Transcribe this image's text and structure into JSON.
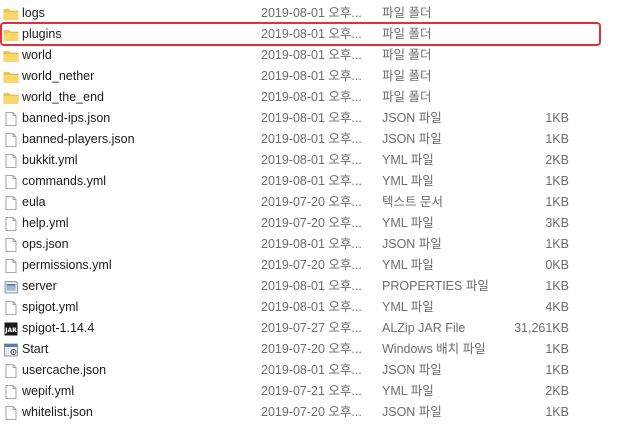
{
  "files": [
    {
      "name": "logs",
      "date": "2019-08-01 오후...",
      "type": "파일 폴더",
      "size": "",
      "icon": "folder-icon"
    },
    {
      "name": "plugins",
      "date": "2019-08-01 오후...",
      "type": "파일 폴더",
      "size": "",
      "icon": "folder-icon"
    },
    {
      "name": "world",
      "date": "2019-08-01 오후...",
      "type": "파일 폴더",
      "size": "",
      "icon": "folder-icon"
    },
    {
      "name": "world_nether",
      "date": "2019-08-01 오후...",
      "type": "파일 폴더",
      "size": "",
      "icon": "folder-icon"
    },
    {
      "name": "world_the_end",
      "date": "2019-08-01 오후...",
      "type": "파일 폴더",
      "size": "",
      "icon": "folder-icon"
    },
    {
      "name": "banned-ips.json",
      "date": "2019-08-01 오후...",
      "type": "JSON 파일",
      "size": "1KB",
      "icon": "file-icon"
    },
    {
      "name": "banned-players.json",
      "date": "2019-08-01 오후...",
      "type": "JSON 파일",
      "size": "1KB",
      "icon": "file-icon"
    },
    {
      "name": "bukkit.yml",
      "date": "2019-08-01 오후...",
      "type": "YML 파일",
      "size": "2KB",
      "icon": "file-icon"
    },
    {
      "name": "commands.yml",
      "date": "2019-08-01 오후...",
      "type": "YML 파일",
      "size": "1KB",
      "icon": "file-icon"
    },
    {
      "name": "eula",
      "date": "2019-07-20 오후...",
      "type": "텍스트 문서",
      "size": "1KB",
      "icon": "file-icon"
    },
    {
      "name": "help.yml",
      "date": "2019-07-20 오후...",
      "type": "YML 파일",
      "size": "3KB",
      "icon": "file-icon"
    },
    {
      "name": "ops.json",
      "date": "2019-08-01 오후...",
      "type": "JSON 파일",
      "size": "1KB",
      "icon": "file-icon"
    },
    {
      "name": "permissions.yml",
      "date": "2019-07-20 오후...",
      "type": "YML 파일",
      "size": "0KB",
      "icon": "file-icon"
    },
    {
      "name": "server",
      "date": "2019-08-01 오후...",
      "type": "PROPERTIES 파일",
      "size": "1KB",
      "icon": "properties-file-icon"
    },
    {
      "name": "spigot.yml",
      "date": "2019-08-01 오후...",
      "type": "YML 파일",
      "size": "4KB",
      "icon": "file-icon"
    },
    {
      "name": "spigot-1.14.4",
      "date": "2019-07-27 오후...",
      "type": "ALZip JAR File",
      "size": "31,261KB",
      "icon": "jar-file-icon"
    },
    {
      "name": "Start",
      "date": "2019-07-20 오후...",
      "type": "Windows 배치 파일",
      "size": "1KB",
      "icon": "batch-file-icon"
    },
    {
      "name": "usercache.json",
      "date": "2019-08-01 오후...",
      "type": "JSON 파일",
      "size": "1KB",
      "icon": "file-icon"
    },
    {
      "name": "wepif.yml",
      "date": "2019-07-21 오후...",
      "type": "YML 파일",
      "size": "2KB",
      "icon": "file-icon"
    },
    {
      "name": "whitelist.json",
      "date": "2019-07-20 오후...",
      "type": "JSON 파일",
      "size": "1KB",
      "icon": "file-icon"
    }
  ],
  "highlighted_row": "plugins",
  "colors": {
    "folder": "#f3c443",
    "highlight": "#e0303a",
    "secondary_text": "#6d6d6d"
  }
}
